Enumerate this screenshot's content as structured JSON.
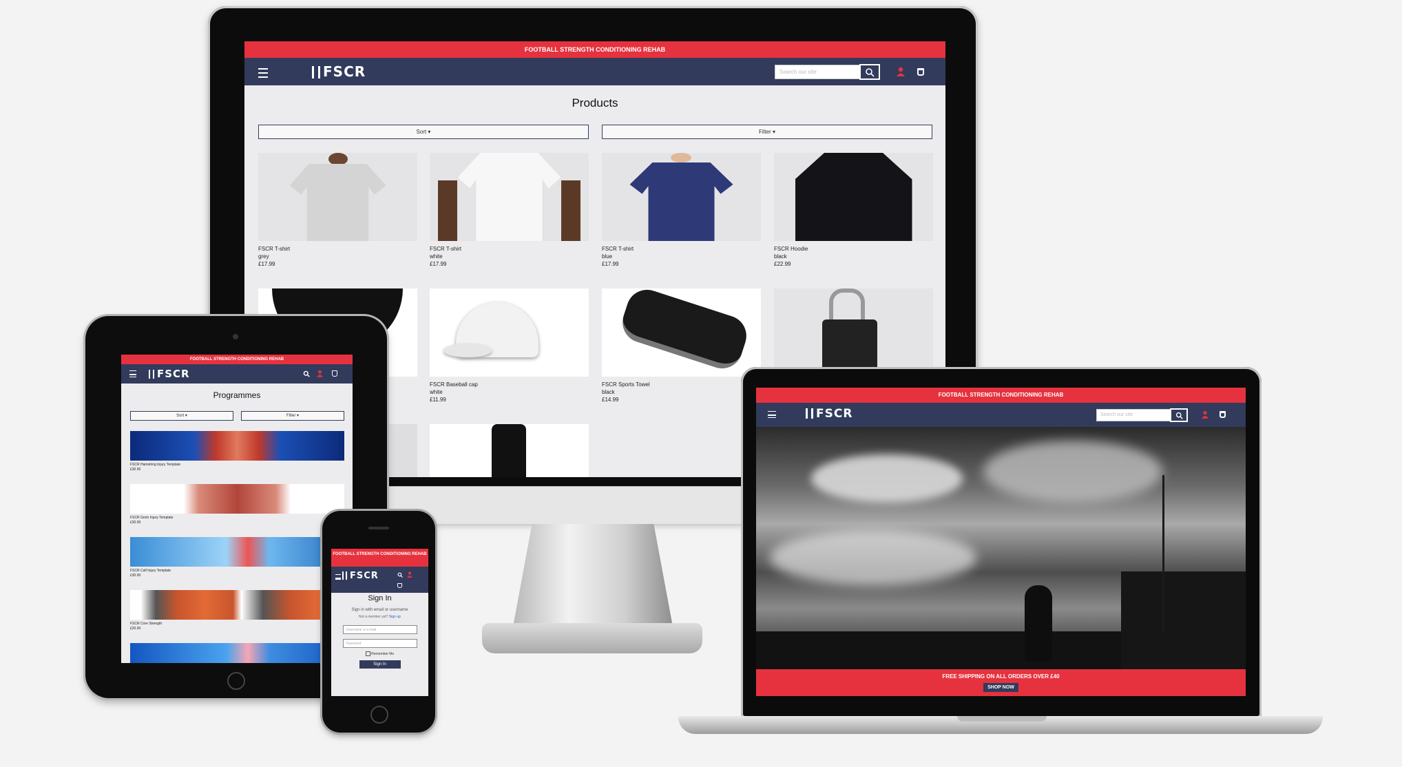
{
  "brand": {
    "logo_text": "FSCR",
    "banner": "FOOTBALL STRENGTH CONDITIONING REHAB",
    "colors": {
      "accent": "#e6323e",
      "navy": "#323b5c",
      "page_bg": "#ececee"
    }
  },
  "desktop": {
    "search_placeholder": "Search our site",
    "page_title": "Products",
    "sort_label": "Sort ▾",
    "filter_label": "Filter ▾",
    "products": [
      {
        "name": "FSCR T-shirt",
        "color": "grey",
        "price": "£17.99"
      },
      {
        "name": "FSCR T-shirt",
        "color": "white",
        "price": "£17.99"
      },
      {
        "name": "FSCR T-shirt",
        "color": "blue",
        "price": "£17.99"
      },
      {
        "name": "FSCR Hoodie",
        "color": "black",
        "price": "£22.99"
      },
      {
        "name": "",
        "color": "",
        "price": ""
      },
      {
        "name": "FSCR Baseball cap",
        "color": "white",
        "price": "£11.99"
      },
      {
        "name": "FSCR Sports Towel",
        "color": "black",
        "price": "£14.99"
      },
      {
        "name": "",
        "color": "",
        "price": ""
      }
    ]
  },
  "tablet": {
    "page_title": "Programmes",
    "sort_label": "Sort ▾",
    "filter_label": "Filter ▾",
    "programmes": [
      {
        "name": "FSCR Hamstring Injury Template",
        "price": "£30.00"
      },
      {
        "name": "FSCR Groin Injury Template",
        "price": "£30.00"
      },
      {
        "name": "FSCR Calf Injury Template",
        "price": "£30.00"
      },
      {
        "name": "FSCR Core Strength",
        "price": "£20.00"
      }
    ]
  },
  "phone": {
    "page_title": "Sign In",
    "subtitle": "Sign in with email or username",
    "signup_prompt": "Not a member yet?",
    "signup_link": "Sign up",
    "username_placeholder": "Username or e-mail",
    "password_placeholder": "Password",
    "remember_label": "Remember Me",
    "signin_button": "Sign In"
  },
  "laptop": {
    "search_placeholder": "Search our site",
    "hero_banner": "FREE SHIPPING ON ALL ORDERS OVER £40",
    "shop_button": "SHOP NOW"
  }
}
